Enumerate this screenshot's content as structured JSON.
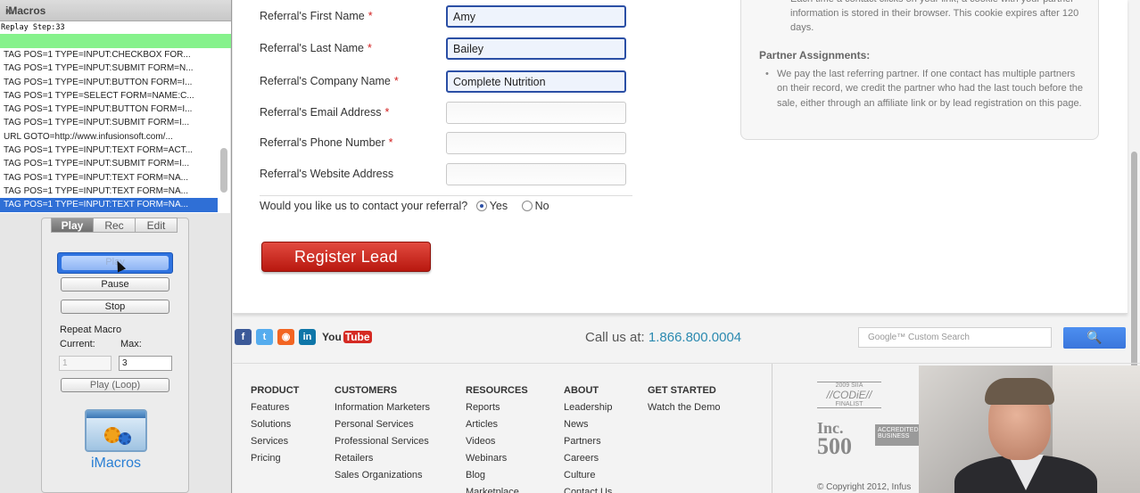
{
  "imacros": {
    "title": "iMacros",
    "close_glyph": "×",
    "replay_status": "Replay Step:33",
    "macro_lines": [
      "TAG POS=1 TYPE=INPUT:CHECKBOX FOR...",
      "TAG POS=1 TYPE=INPUT:SUBMIT FORM=N...",
      "TAG POS=1 TYPE=INPUT:BUTTON FORM=I...",
      "TAG POS=1 TYPE=SELECT FORM=NAME:C...",
      "TAG POS=1 TYPE=INPUT:BUTTON FORM=I...",
      "TAG POS=1 TYPE=INPUT:SUBMIT FORM=I...",
      "URL GOTO=http://www.infusionsoft.com/...",
      "TAG POS=1 TYPE=INPUT:TEXT FORM=ACT...",
      "TAG POS=1 TYPE=INPUT:SUBMIT FORM=I...",
      "TAG POS=1 TYPE=INPUT:TEXT FORM=NA...",
      "TAG POS=1 TYPE=INPUT:TEXT FORM=NA...",
      "TAG POS=1 TYPE=INPUT:TEXT FORM=NA..."
    ],
    "selected_line": 11,
    "tabs": [
      "Play",
      "Rec",
      "Edit"
    ],
    "active_tab": "Play",
    "play_label": "Play",
    "pause_label": "Pause",
    "stop_label": "Stop",
    "repeat_label": "Repeat Macro",
    "current_label": "Current:",
    "max_label": "Max:",
    "current_value": "1",
    "max_value": "3",
    "loop_label": "Play (Loop)",
    "logo_text": "iMacros"
  },
  "form": {
    "fields": [
      {
        "label": "Referral's First Name",
        "required": true,
        "value": "Amy",
        "focused": true
      },
      {
        "label": "Referral's Last Name",
        "required": true,
        "value": "Bailey",
        "focused": true
      },
      {
        "label": "Referral's Company Name",
        "required": true,
        "value": "Complete Nutrition",
        "focused": true
      },
      {
        "label": "Referral's Email Address",
        "required": true,
        "value": "",
        "focused": false
      },
      {
        "label": "Referral's Phone Number",
        "required": true,
        "value": "",
        "focused": false
      },
      {
        "label": "Referral's Website Address",
        "required": false,
        "value": "",
        "focused": false
      }
    ],
    "required_mark": "*",
    "contact_question": "Would you like us to contact your referral?",
    "yes_label": "Yes",
    "no_label": "No",
    "contact_choice": "Yes",
    "submit_label": "Register Lead"
  },
  "partner_box": {
    "top_text": "Each time a contact clicks on your link, a cookie with your partner information is stored in their browser. This cookie expires after 120 days.",
    "heading": "Partner Assignments:",
    "bullet": "We pay the last referring partner. If one contact has multiple partners on their record, we credit the partner who had the last touch before the sale, either through an affiliate link or by lead registration on this page."
  },
  "footer_bar": {
    "social_icons": [
      {
        "name": "facebook-icon",
        "glyph": "f",
        "color": "#3b5998"
      },
      {
        "name": "twitter-icon",
        "glyph": "t",
        "color": "#55acee"
      },
      {
        "name": "rss-icon",
        "glyph": "◉",
        "color": "#f26522"
      },
      {
        "name": "linkedin-icon",
        "glyph": "in",
        "color": "#0e76a8"
      }
    ],
    "youtube_you": "You",
    "youtube_tube": "Tube",
    "call_prefix": "Call us at:",
    "phone": "1.866.800.0004",
    "search_placeholder": "Google™ Custom Search",
    "search_glyph": "🔍"
  },
  "footer_columns": [
    {
      "heading": "PRODUCT",
      "items": [
        "Features",
        "Solutions",
        "Services",
        "Pricing"
      ]
    },
    {
      "heading": "CUSTOMERS",
      "items": [
        "Information Marketers",
        "Personal Services",
        "Professional Services",
        "Retailers",
        "Sales Organizations"
      ]
    },
    {
      "heading": "RESOURCES",
      "items": [
        "Reports",
        "Articles",
        "Videos",
        "Webinars",
        "Blog",
        "Marketplace"
      ]
    },
    {
      "heading": "ABOUT",
      "items": [
        "Leadership",
        "News",
        "Partners",
        "Careers",
        "Culture",
        "Contact Us"
      ]
    },
    {
      "heading": "GET STARTED",
      "items": [
        "Watch the Demo"
      ]
    }
  ],
  "badges": {
    "codie_year": "2009 SIIA",
    "codie": "//CODiE//",
    "codie_sub": "FINALIST",
    "inc": "Inc.",
    "inc_num": "500",
    "bbb": "ACCREDITED BUSINESS"
  },
  "copyright": "© Copyright 2012, Infus"
}
